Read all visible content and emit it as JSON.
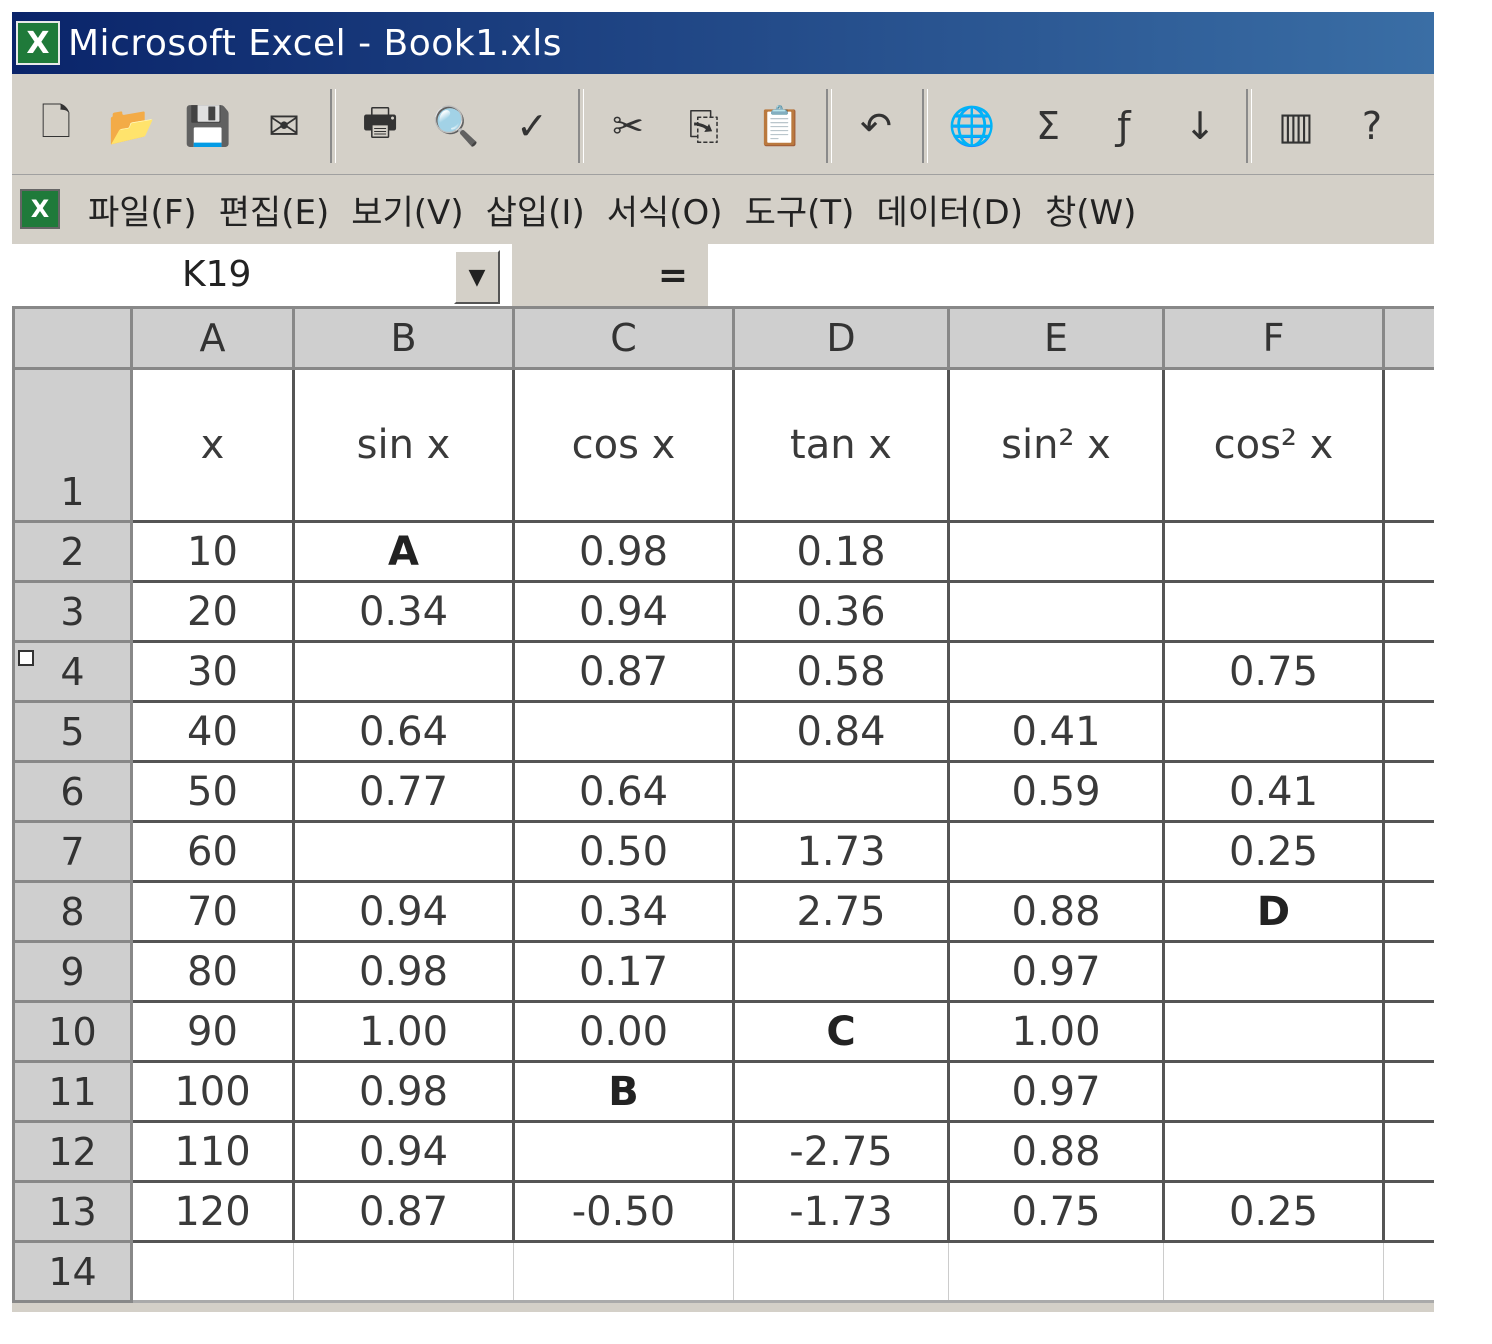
{
  "window": {
    "title": "Microsoft Excel - Book1.xls",
    "app_icon_glyph": "X"
  },
  "toolbar": {
    "buttons": [
      {
        "name": "new-icon",
        "glyph": "🗋"
      },
      {
        "name": "open-icon",
        "glyph": "📂"
      },
      {
        "name": "save-icon",
        "glyph": "💾"
      },
      {
        "name": "email-icon",
        "glyph": "✉"
      },
      {
        "name": "print-icon",
        "glyph": "🖶"
      },
      {
        "name": "print-preview-icon",
        "glyph": "🔍"
      },
      {
        "name": "spelling-icon",
        "glyph": "✓"
      },
      {
        "name": "cut-icon",
        "glyph": "✂"
      },
      {
        "name": "copy-icon",
        "glyph": "⎘"
      },
      {
        "name": "paste-icon",
        "glyph": "📋"
      },
      {
        "name": "undo-icon",
        "glyph": "↶"
      },
      {
        "name": "hyperlink-icon",
        "glyph": "🌐"
      },
      {
        "name": "autosum-icon",
        "glyph": "Σ"
      },
      {
        "name": "function-icon",
        "glyph": "ƒ"
      },
      {
        "name": "sort-icon",
        "glyph": "↓"
      },
      {
        "name": "chart-icon",
        "glyph": "▥"
      },
      {
        "name": "help-icon",
        "glyph": "?"
      }
    ]
  },
  "menu": {
    "icon_glyph": "X",
    "items": [
      "파일(F)",
      "편집(E)",
      "보기(V)",
      "삽입(I)",
      "서식(O)",
      "도구(T)",
      "데이터(D)",
      "창(W)"
    ]
  },
  "formula_bar": {
    "name_box": "K19",
    "equals": "=",
    "formula": ""
  },
  "sheet": {
    "columns": [
      "A",
      "B",
      "C",
      "D",
      "E",
      "F"
    ],
    "header_row": {
      "row_label": "1",
      "cells": [
        "x",
        "sin x",
        "cos x",
        "tan x",
        "sin² x",
        "cos² x"
      ]
    },
    "rows": [
      {
        "label": "2",
        "cells": [
          "10",
          "A",
          "0.98",
          "0.18",
          "",
          ""
        ]
      },
      {
        "label": "3",
        "cells": [
          "20",
          "0.34",
          "0.94",
          "0.36",
          "",
          ""
        ]
      },
      {
        "label": "4",
        "cells": [
          "30",
          "",
          "0.87",
          "0.58",
          "",
          "0.75"
        ]
      },
      {
        "label": "5",
        "cells": [
          "40",
          "0.64",
          "",
          "0.84",
          "0.41",
          ""
        ]
      },
      {
        "label": "6",
        "cells": [
          "50",
          "0.77",
          "0.64",
          "",
          "0.59",
          "0.41"
        ]
      },
      {
        "label": "7",
        "cells": [
          "60",
          "",
          "0.50",
          "1.73",
          "",
          "0.25"
        ]
      },
      {
        "label": "8",
        "cells": [
          "70",
          "0.94",
          "0.34",
          "2.75",
          "0.88",
          "D"
        ]
      },
      {
        "label": "9",
        "cells": [
          "80",
          "0.98",
          "0.17",
          "",
          "0.97",
          ""
        ]
      },
      {
        "label": "10",
        "cells": [
          "90",
          "1.00",
          "0.00",
          "C",
          "1.00",
          ""
        ]
      },
      {
        "label": "11",
        "cells": [
          "100",
          "0.98",
          "B",
          "",
          "0.97",
          ""
        ]
      },
      {
        "label": "12",
        "cells": [
          "110",
          "0.94",
          "",
          "-2.75",
          "0.88",
          ""
        ]
      },
      {
        "label": "13",
        "cells": [
          "120",
          "0.87",
          "-0.50",
          "-1.73",
          "0.75",
          "0.25"
        ]
      }
    ],
    "last_row_label": "14"
  }
}
